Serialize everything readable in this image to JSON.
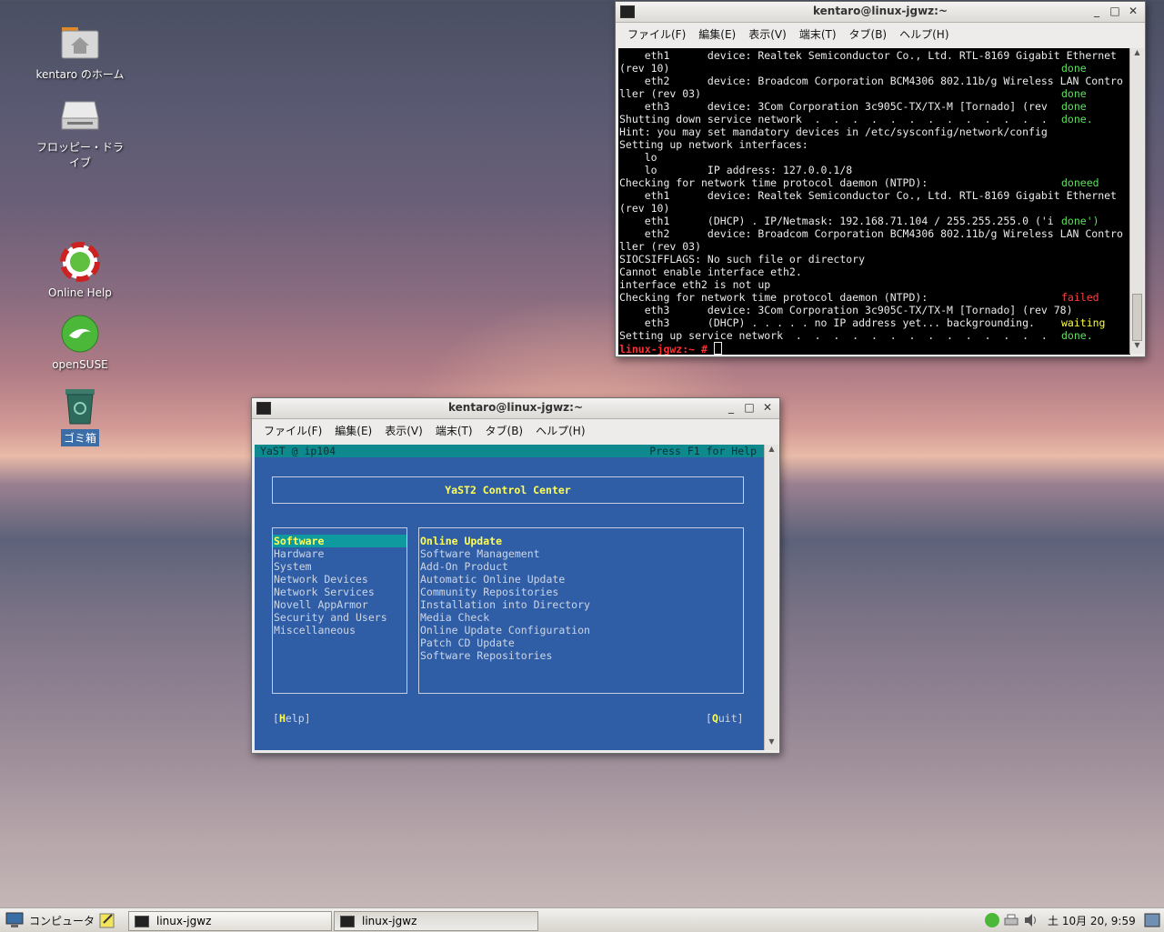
{
  "desktop": {
    "icons": [
      {
        "label": "kentaro のホーム",
        "icon": "home-folder-icon"
      },
      {
        "label": "フロッピー・ドライブ",
        "icon": "floppy-drive-icon"
      },
      {
        "label": "Online Help",
        "icon": "help-lifebuoy-icon"
      },
      {
        "label": "openSUSE",
        "icon": "opensuse-gecko-icon"
      },
      {
        "label": "ゴミ箱",
        "icon": "trash-icon"
      }
    ]
  },
  "terminal1": {
    "title": "kentaro@linux-jgwz:~",
    "menu": [
      "ファイル(F)",
      "編集(E)",
      "表示(V)",
      "端末(T)",
      "タブ(B)",
      "ヘルプ(H)"
    ],
    "lines": [
      {
        "text": "    eth1      device: Realtek Semiconductor Co., Ltd. RTL-8169 Gigabit Ethernet",
        "status": ""
      },
      {
        "text": "(rev 10)",
        "status": "done"
      },
      {
        "text": "    eth2      device: Broadcom Corporation BCM4306 802.11b/g Wireless LAN Contro",
        "status": ""
      },
      {
        "text": "ller (rev 03)",
        "status": "done"
      },
      {
        "text": "    eth3      device: 3Com Corporation 3c905C-TX/TX-M [Tornado] (rev",
        "status": "done"
      },
      {
        "text": "Shutting down service network  .  .  .  .  .  .  .  .  .  .  .  .  .",
        "status": "done."
      },
      {
        "text": "Hint: you may set mandatory devices in /etc/sysconfig/network/config",
        "status": ""
      },
      {
        "text": "Setting up network interfaces:",
        "status": ""
      },
      {
        "text": "    lo",
        "status": ""
      },
      {
        "text": "    lo        IP address: 127.0.0.1/8",
        "status": ""
      },
      {
        "text": "Checking for network time protocol daemon (NTPD):",
        "status": "doneed"
      },
      {
        "text": "    eth1      device: Realtek Semiconductor Co., Ltd. RTL-8169 Gigabit Ethernet",
        "status": ""
      },
      {
        "text": "(rev 10)",
        "status": ""
      },
      {
        "text": "    eth1      (DHCP) . IP/Netmask: 192.168.71.104 / 255.255.255.0 ('i",
        "status": "done')"
      },
      {
        "text": "    eth2      device: Broadcom Corporation BCM4306 802.11b/g Wireless LAN Contro",
        "status": ""
      },
      {
        "text": "ller (rev 03)",
        "status": ""
      },
      {
        "text": "SIOCSIFFLAGS: No such file or directory",
        "status": ""
      },
      {
        "text": "Cannot enable interface eth2.",
        "status": ""
      },
      {
        "text": "interface eth2 is not up",
        "status": ""
      },
      {
        "text": "Checking for network time protocol daemon (NTPD):",
        "status": "failed"
      },
      {
        "text": "    eth3      device: 3Com Corporation 3c905C-TX/TX-M [Tornado] (rev 78)",
        "status": ""
      },
      {
        "text": "    eth3      (DHCP) . . . . . no IP address yet... backgrounding.",
        "status": "waiting"
      },
      {
        "text": "Setting up service network  .  .  .  .  .  .  .  .  .  .  .  .  .  .",
        "status": "done."
      }
    ],
    "prompt": "linux-jgwz:~ #"
  },
  "terminal2": {
    "title": "kentaro@linux-jgwz:~",
    "menu": [
      "ファイル(F)",
      "編集(E)",
      "表示(V)",
      "端末(T)",
      "タブ(B)",
      "ヘルプ(H)"
    ]
  },
  "yast": {
    "header_left": "YaST @ ip104",
    "header_right": "Press F1 for Help",
    "title": "YaST2 Control Center",
    "categories": [
      "Software",
      "Hardware",
      "System",
      "Network Devices",
      "Network Services",
      "Novell AppArmor",
      "Security and Users",
      "Miscellaneous"
    ],
    "modules": [
      "Online Update",
      "Software Management",
      "Add-On Product",
      "Automatic Online Update",
      "Community Repositories",
      "Installation into Directory",
      "Media Check",
      "Online Update Configuration",
      "Patch CD Update",
      "Software Repositories"
    ],
    "help_button": {
      "pre": "[",
      "key": "H",
      "post": "elp]"
    },
    "quit_button": {
      "pre": "[",
      "key": "Q",
      "post": "uit]"
    }
  },
  "taskbar": {
    "computer": "コンピュータ",
    "tasks": [
      "linux-jgwz",
      "linux-jgwz"
    ],
    "clock": "土 10月 20, 9:59"
  }
}
